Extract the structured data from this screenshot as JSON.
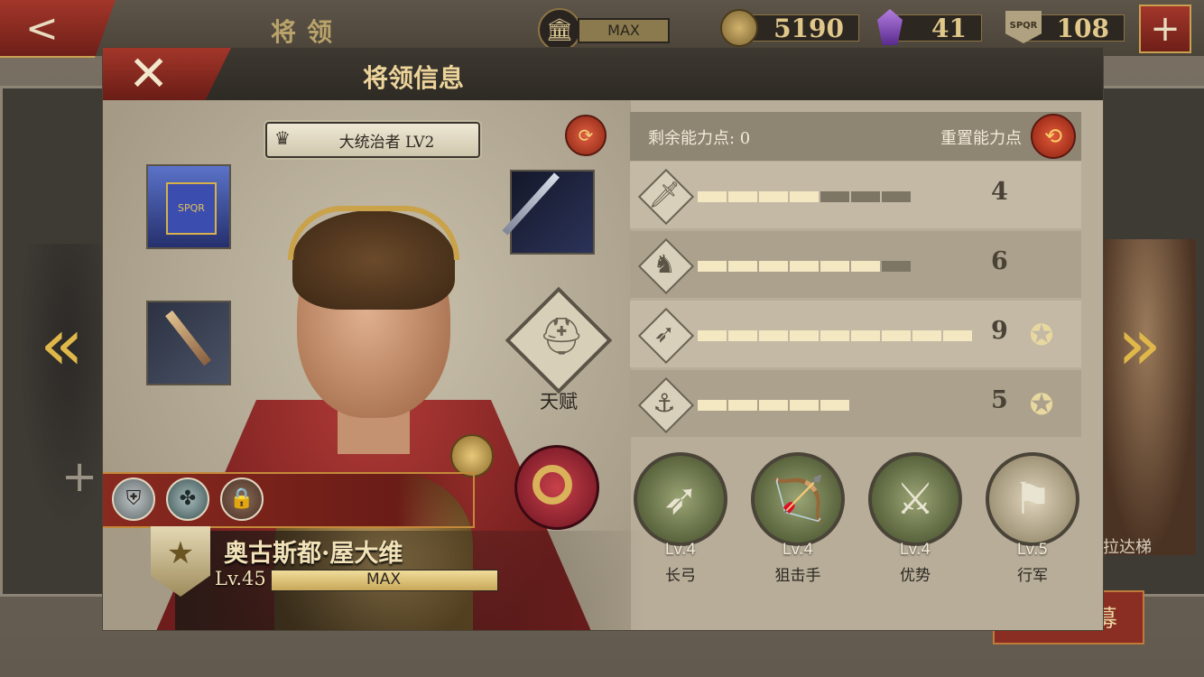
{
  "topbar": {
    "screen_title": "将领",
    "building_max": "MAX",
    "coins": "5190",
    "gems": "41",
    "honor": "108",
    "plus_label": "+",
    "back_label": "<"
  },
  "background": {
    "right_hero_name": "拉达梯",
    "recruit_label": "募",
    "left_plus": "+"
  },
  "dialog": {
    "title": "将领信息",
    "close_label": "✕"
  },
  "hero": {
    "rank_title": "大统治者 LV2",
    "name": "奥古斯都·屋大维",
    "level": "Lv.45",
    "exp_label": "MAX",
    "talent_label": "天赋",
    "spqr_text": "SPQR"
  },
  "stats": {
    "remaining_label": "剩余能力点: 0",
    "reset_label": "重置能力点",
    "rows": [
      {
        "icon": "sword-icon",
        "glyph": "🗡",
        "value": "4",
        "filled": 4,
        "total": 7,
        "medal": false
      },
      {
        "icon": "horse-icon",
        "glyph": "♞",
        "value": "6",
        "filled": 6,
        "total": 7,
        "medal": false
      },
      {
        "icon": "bow-icon",
        "glyph": "➶",
        "value": "9",
        "filled": 9,
        "total": 9,
        "medal": true
      },
      {
        "icon": "anchor-icon",
        "glyph": "⚓",
        "value": "5",
        "filled": 5,
        "total": 5,
        "medal": true
      }
    ]
  },
  "skills": [
    {
      "level": "Lv.4",
      "name": "长弓",
      "icon": "longbow-icon"
    },
    {
      "level": "Lv.4",
      "name": "狙击手",
      "icon": "archer-icon"
    },
    {
      "level": "Lv.4",
      "name": "优势",
      "icon": "archer-group-icon"
    },
    {
      "level": "Lv.5",
      "name": "行军",
      "icon": "march-icon"
    }
  ],
  "colors": {
    "accent_red": "#8a2a20",
    "gold": "#e0b84a",
    "bar_on": "#f3e8c2",
    "bar_off": "#7e7665"
  }
}
